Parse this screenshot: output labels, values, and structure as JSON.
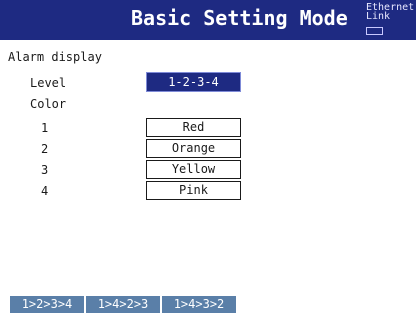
{
  "header": {
    "title": "Basic Setting Mode",
    "ethernet_label": "Ethernet",
    "link_label": "Link"
  },
  "alarm": {
    "section_title": "Alarm display",
    "level_label": "Level",
    "level_value": "1-2-3-4",
    "color_label": "Color",
    "rows": [
      {
        "index": "1",
        "color": "Red"
      },
      {
        "index": "2",
        "color": "Orange"
      },
      {
        "index": "3",
        "color": "Yellow"
      },
      {
        "index": "4",
        "color": "Pink"
      }
    ]
  },
  "softkeys": [
    {
      "label": "1>2>3>4"
    },
    {
      "label": "1>4>2>3"
    },
    {
      "label": "1>4>3>2"
    }
  ],
  "colors": {
    "header_bg": "#1e2a82",
    "selected_bg": "#1e2a82",
    "softkey_bg": "#5a7fa8"
  }
}
